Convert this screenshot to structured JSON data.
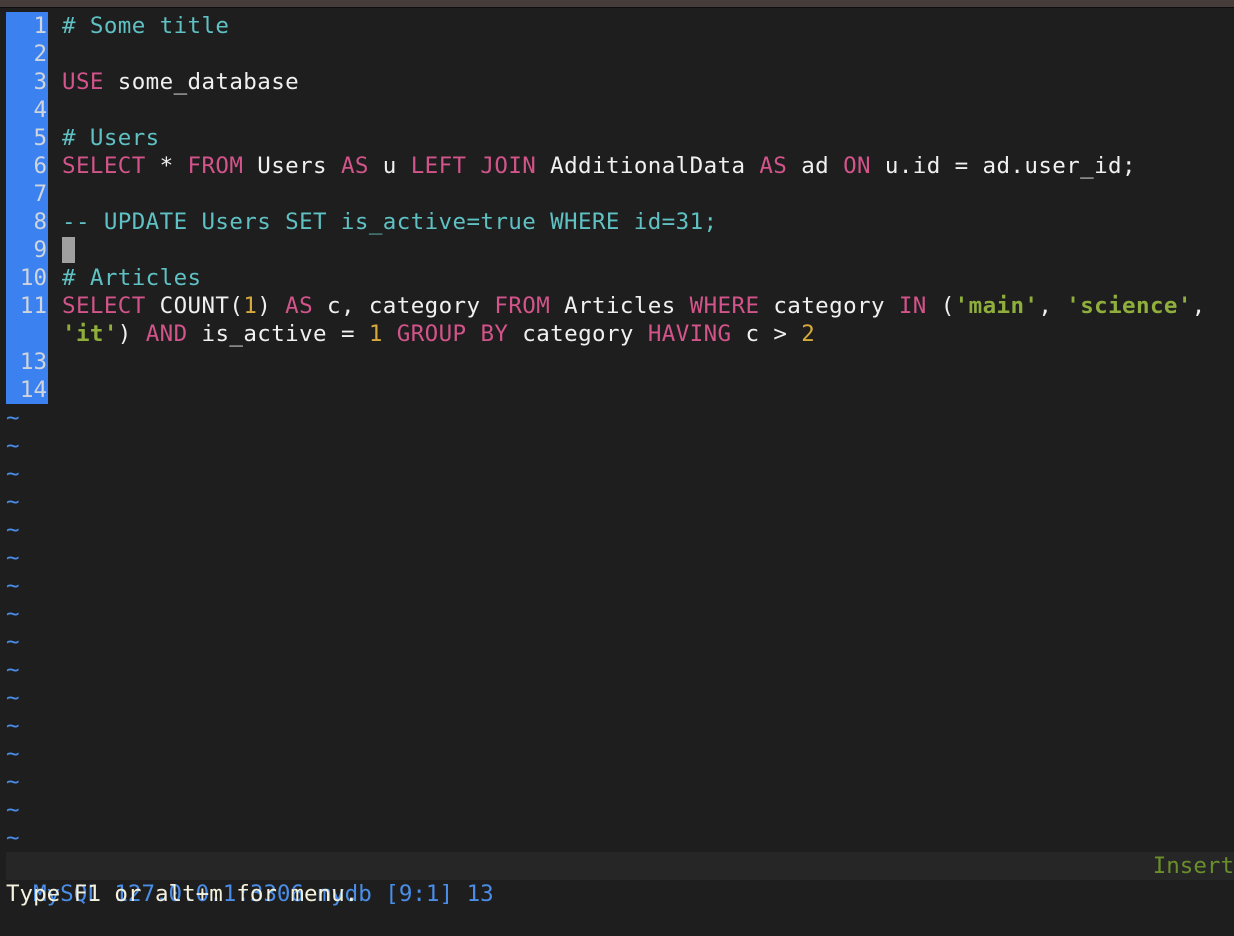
{
  "editor": {
    "lines": [
      {
        "number": "1",
        "tokens": [
          {
            "t": "# Some title",
            "c": "cm"
          }
        ]
      },
      {
        "number": "2",
        "tokens": []
      },
      {
        "number": "3",
        "tokens": [
          {
            "t": "USE",
            "c": "kw"
          },
          {
            "t": " some_database",
            "c": "id"
          }
        ]
      },
      {
        "number": "4",
        "tokens": []
      },
      {
        "number": "5",
        "tokens": [
          {
            "t": "# Users",
            "c": "cm"
          }
        ]
      },
      {
        "number": "6",
        "tokens": [
          {
            "t": "SELECT",
            "c": "kw"
          },
          {
            "t": " * ",
            "c": "id"
          },
          {
            "t": "FROM",
            "c": "kw"
          },
          {
            "t": " Users ",
            "c": "id"
          },
          {
            "t": "AS",
            "c": "kw"
          },
          {
            "t": " u ",
            "c": "id"
          },
          {
            "t": "LEFT JOIN",
            "c": "kw"
          },
          {
            "t": " AdditionalData ",
            "c": "id"
          },
          {
            "t": "AS",
            "c": "kw"
          },
          {
            "t": " ad ",
            "c": "id"
          },
          {
            "t": "ON",
            "c": "kw"
          },
          {
            "t": " u.id = ad.user_id;",
            "c": "id"
          }
        ]
      },
      {
        "number": "7",
        "tokens": []
      },
      {
        "number": "8",
        "tokens": [
          {
            "t": "-- UPDATE Users SET is_active=true WHERE id=31;",
            "c": "cm"
          }
        ]
      },
      {
        "number": "9",
        "tokens": [],
        "cursor": true
      },
      {
        "number": "10",
        "tokens": [
          {
            "t": "# Articles",
            "c": "cm"
          }
        ]
      },
      {
        "number": "11",
        "tokens": [
          {
            "t": "SELECT",
            "c": "kw"
          },
          {
            "t": " COUNT(",
            "c": "id"
          },
          {
            "t": "1",
            "c": "num"
          },
          {
            "t": ") ",
            "c": "id"
          },
          {
            "t": "AS",
            "c": "kw"
          },
          {
            "t": " c, category ",
            "c": "id"
          },
          {
            "t": "FROM",
            "c": "kw"
          },
          {
            "t": " Articles ",
            "c": "id"
          },
          {
            "t": "WHERE",
            "c": "kw"
          },
          {
            "t": " category ",
            "c": "id"
          },
          {
            "t": "IN",
            "c": "kw"
          },
          {
            "t": " (",
            "c": "id"
          },
          {
            "t": "'main'",
            "c": "str"
          },
          {
            "t": ", ",
            "c": "id"
          },
          {
            "t": "'science'",
            "c": "str"
          },
          {
            "t": ",",
            "c": "id"
          }
        ]
      },
      {
        "number": "",
        "tokens": [
          {
            "t": "'it'",
            "c": "str"
          },
          {
            "t": ") ",
            "c": "id"
          },
          {
            "t": "AND",
            "c": "kw"
          },
          {
            "t": " is_active = ",
            "c": "id"
          },
          {
            "t": "1",
            "c": "num"
          },
          {
            "t": " ",
            "c": "id"
          },
          {
            "t": "GROUP BY",
            "c": "kw"
          },
          {
            "t": " category ",
            "c": "id"
          },
          {
            "t": "HAVING",
            "c": "kw"
          },
          {
            "t": " c > ",
            "c": "id"
          },
          {
            "t": "2",
            "c": "num"
          }
        ]
      },
      {
        "number": "13",
        "tokens": []
      },
      {
        "number": "14",
        "tokens": []
      }
    ],
    "empty_line_marker": "~",
    "empty_line_count": 16
  },
  "statusbar": {
    "connection": "MySQL 127.0.0.1:3306 mydb [9:1] 13",
    "mode": "Insert"
  },
  "message_line": "Type F1 or alt+m for menu."
}
